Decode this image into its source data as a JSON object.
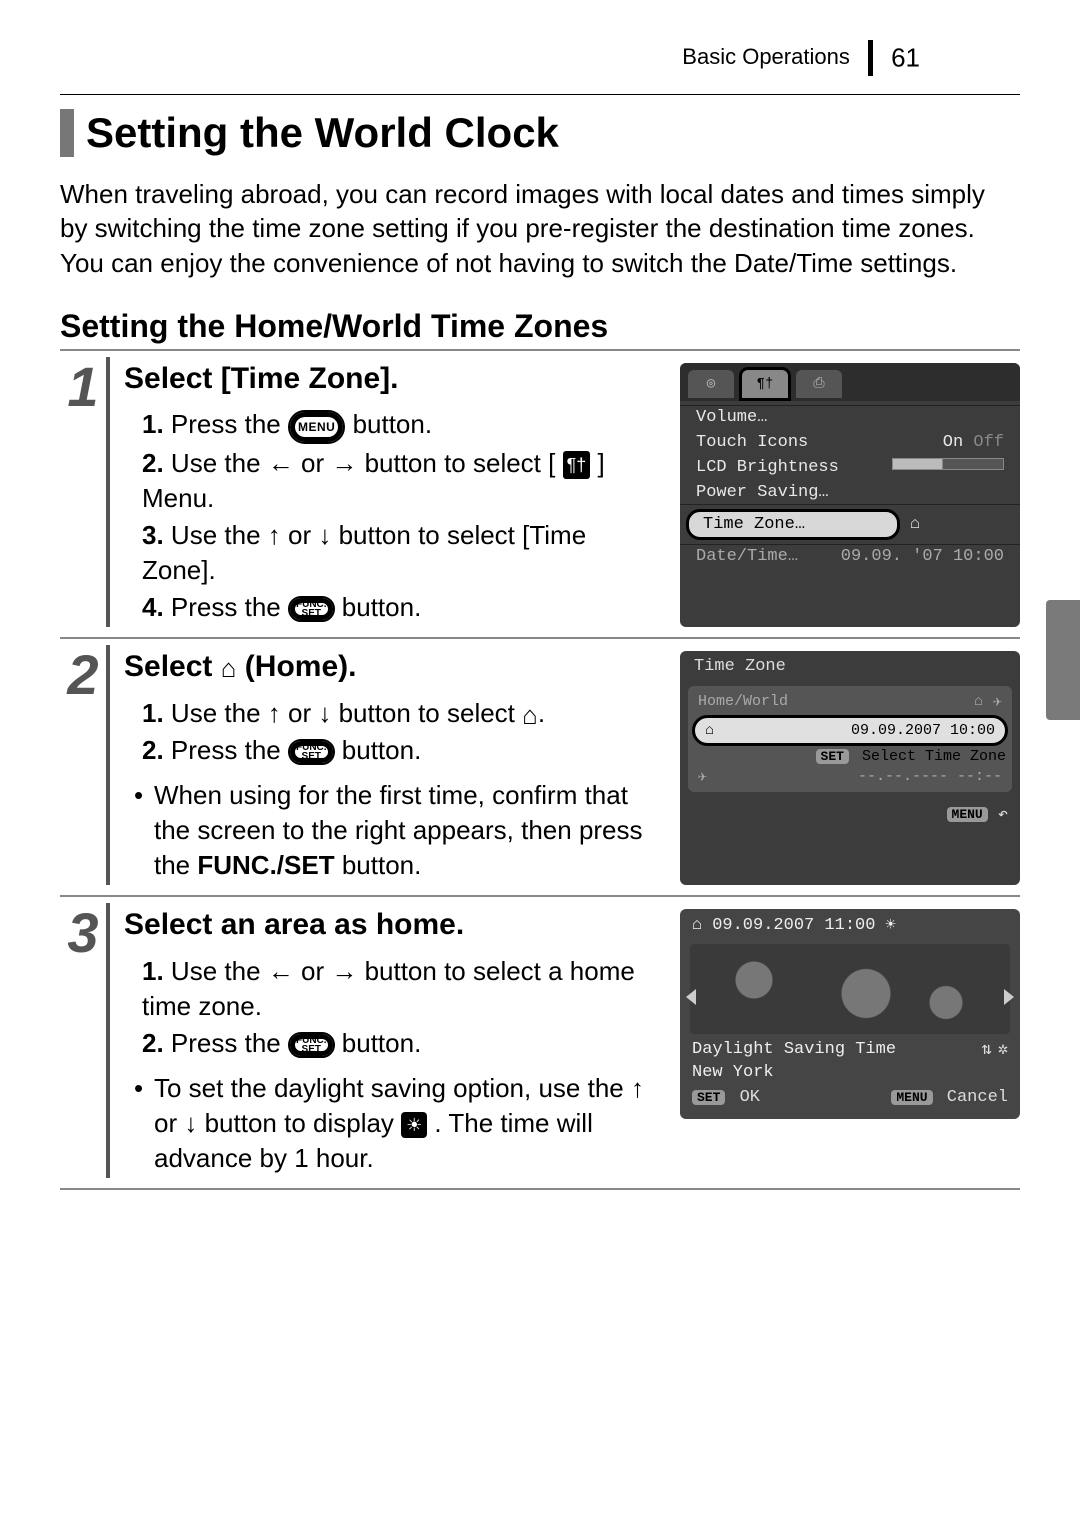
{
  "header": {
    "section": "Basic Operations",
    "page": "61"
  },
  "title": "Setting the World Clock",
  "intro": "When traveling abroad, you can record images with local dates and times simply by switching the time zone setting if you pre-register the destination time zones. You can enjoy the convenience of not having to switch the Date/Time settings.",
  "subTitle": "Setting the Home/World Time Zones",
  "btn": {
    "menu": "MENU",
    "funcTop": "FUNC.",
    "funcBot": "SET"
  },
  "steps": {
    "s1": {
      "num": "1",
      "heading": "Select [Time Zone].",
      "i1a": "1.",
      "i1b": "Press the ",
      "i1c": " button.",
      "i2a": "2.",
      "i2b": "Use the ",
      "i2c": " or ",
      "i2d": " button to select [",
      "i2e": "] Menu.",
      "i3a": "3.",
      "i3b": "Use the ",
      "i3c": " or ",
      "i3d": " button to select [Time Zone].",
      "i4a": "4.",
      "i4b": "Press the ",
      "i4c": " button."
    },
    "s2": {
      "num": "2",
      "headingA": "Select ",
      "headingB": " (Home).",
      "i1a": "1.",
      "i1b": "Use the ",
      "i1c": " or ",
      "i1d": " button to select ",
      "i2a": "2.",
      "i2b": "Press the ",
      "i2c": " button.",
      "noteA": "When using for the first time, confirm that the screen to the right appears, then press the ",
      "noteB": "FUNC./SET",
      "noteC": " button."
    },
    "s3": {
      "num": "3",
      "heading": "Select an area as home.",
      "i1a": "1.",
      "i1b": "Use the ",
      "i1c": " or ",
      "i1d": " button to select a home time zone.",
      "i2a": "2.",
      "i2b": "Press the ",
      "i2c": " button.",
      "noteA": "To set the daylight saving option, use the ",
      "noteB": " or ",
      "noteC": " button to display ",
      "noteD": ". The time will advance by 1 hour."
    }
  },
  "screen1": {
    "volume": "Volume…",
    "touchIcons": "Touch Icons",
    "on": "On",
    "off": "Off",
    "lcd": "LCD Brightness",
    "powerSaving": "Power Saving…",
    "timeZone": "Time Zone…",
    "dateTime": "Date/Time…",
    "dateVal": "09.09. '07 10:00"
  },
  "screen2": {
    "title": "Time Zone",
    "homeWorld": "Home/World",
    "dateSel": "09.09.2007 10:00",
    "setLabel": "SET",
    "selectLine": "Select Time Zone",
    "empty": "--.--.---- --:--",
    "menu": "MENU"
  },
  "screen3": {
    "topDate": "09.09.2007 11:00",
    "dst": "Daylight Saving Time",
    "city": "New York",
    "set": "SET",
    "ok": "OK",
    "menu": "MENU",
    "cancel": "Cancel"
  }
}
